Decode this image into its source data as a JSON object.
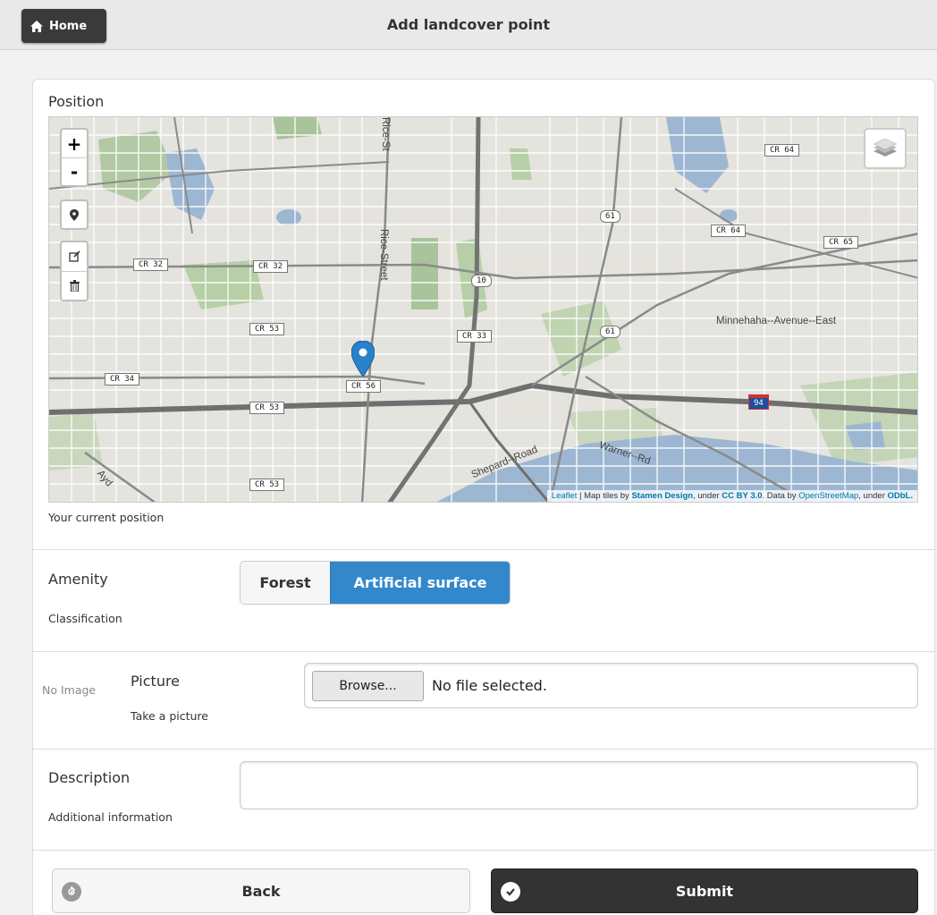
{
  "header": {
    "home_label": "Home",
    "title": "Add landcover point"
  },
  "position": {
    "label": "Position",
    "hint": "Your current position",
    "map": {
      "zoom_in": "+",
      "zoom_out": "-",
      "attribution": {
        "leaflet": "Leaflet",
        "text1": " | Map tiles by ",
        "stamen": "Stamen Design",
        "text2": ", under ",
        "ccby": "CC BY 3.0",
        "text3": ". Data by ",
        "osm": "OpenStreetMap",
        "text4": ", under ",
        "odbl": "ODbL."
      },
      "labels": {
        "cr64a": "CR 64",
        "cr64b": "CR 64",
        "cr65": "CR 65",
        "cr32a": "CR 32",
        "cr32b": "CR 32",
        "cr53a": "CR 53",
        "cr53b": "CR 53",
        "cr53c": "CR 53",
        "cr33": "CR 33",
        "cr34": "CR 34",
        "cr56": "CR 56",
        "us61a": "61",
        "us61b": "61",
        "us10": "10",
        "i94": "94",
        "rice1": "Rice-St",
        "rice2": "Rice-Street",
        "minnehaha": "Minnehaha--Avenue--East",
        "shepard": "Shepard--Road",
        "warner": "Warner--Rd",
        "ayd": "Ayd"
      }
    }
  },
  "amenity": {
    "label": "Amenity",
    "hint": "Classification",
    "options": [
      "Forest",
      "Artificial surface"
    ],
    "selected": "Artificial surface"
  },
  "picture": {
    "no_image": "No Image",
    "label": "Picture",
    "hint": "Take a picture",
    "browse": "Browse...",
    "status": "No file selected."
  },
  "description": {
    "label": "Description",
    "hint": "Additional information",
    "value": ""
  },
  "actions": {
    "back": "Back",
    "submit": "Submit"
  },
  "colors": {
    "accent": "#3388cc",
    "dark": "#333333"
  }
}
